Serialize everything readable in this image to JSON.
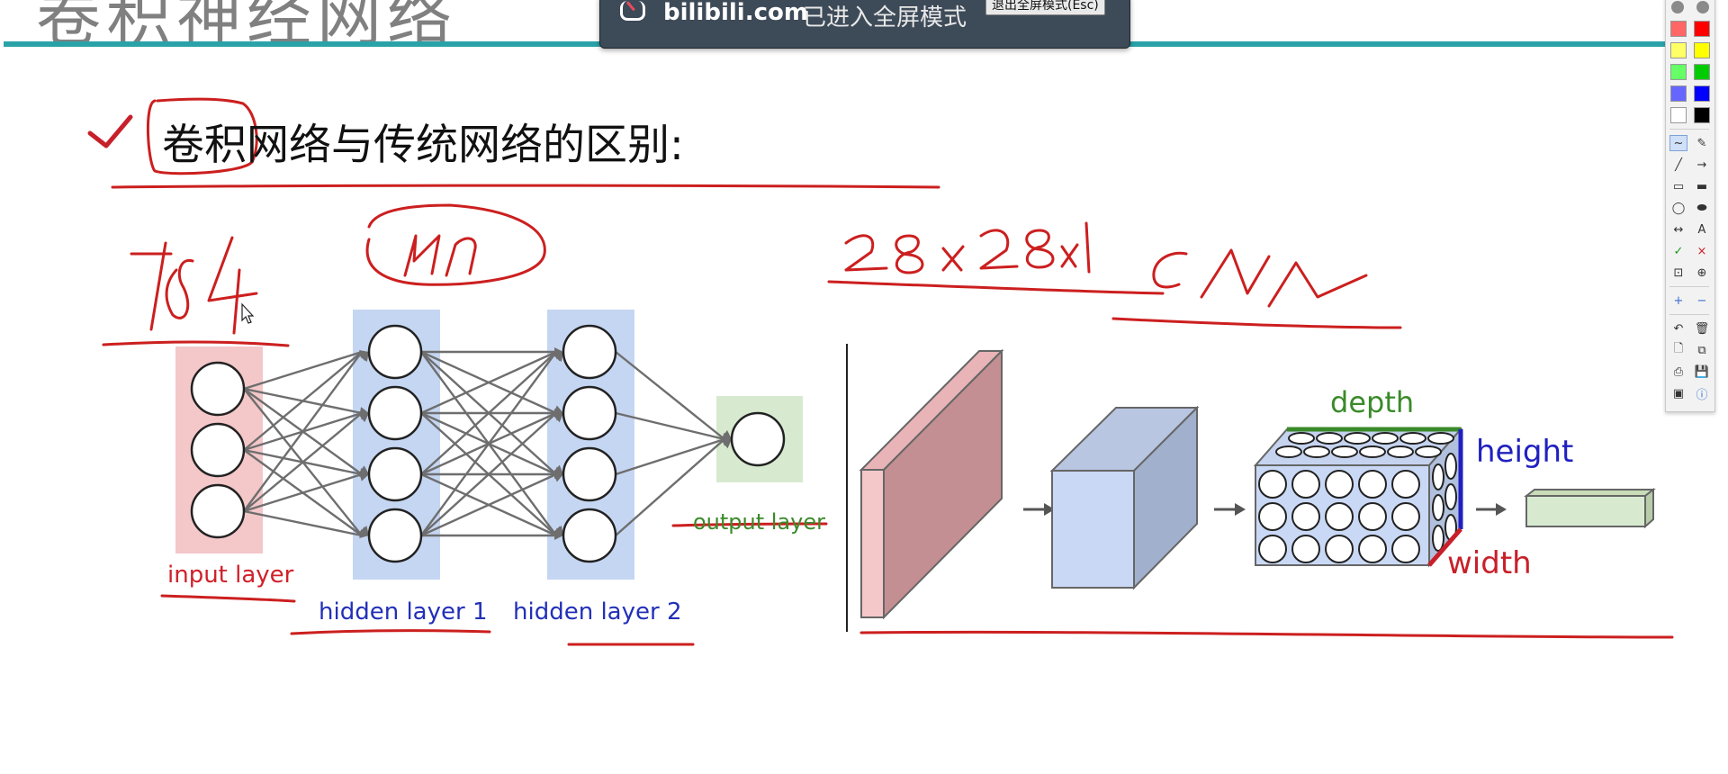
{
  "slide": {
    "title_partial": "卷积神经网络",
    "heading": "卷积网络与传统网络的区别:"
  },
  "notification": {
    "site": "bilibili.com",
    "message": "已进入全屏模式",
    "exit_button": "退出全屏模式(Esc)"
  },
  "nn_diagram": {
    "labels": {
      "input": "input layer",
      "hidden1": "hidden layer 1",
      "hidden2": "hidden layer 2",
      "output": "output layer"
    },
    "colors": {
      "input_band": "#f4c7c9",
      "hidden_band": "#c5d6f2",
      "output_band": "#d7ead0"
    }
  },
  "cnn_diagram": {
    "labels": {
      "depth": "depth",
      "height": "height",
      "width": "width"
    },
    "colors": {
      "depth": "#3a8a2a",
      "height": "#2020c0",
      "width": "#c8202a"
    }
  },
  "annotations": {
    "handwritten_784": "784",
    "handwritten_nn": "NN",
    "handwritten_28": "28×28×1",
    "handwritten_cnn": "CNN"
  },
  "toolbar": {
    "colors": [
      "#ff6666",
      "#ff0000",
      "#ffff66",
      "#ffff00",
      "#66ff66",
      "#00cc00",
      "#6666ff",
      "#0000ff",
      "#ffffff",
      "#000000"
    ],
    "tools": [
      {
        "left": "freehand-icon",
        "right": "highlighter-icon",
        "left_glyph": "~",
        "right_glyph": "✎"
      },
      {
        "left": "line-icon",
        "right": "arrow-icon",
        "left_glyph": "╱",
        "right_glyph": "→"
      },
      {
        "left": "rect-icon",
        "right": "filled-rect-icon",
        "left_glyph": "▭",
        "right_glyph": "▬"
      },
      {
        "left": "ellipse-icon",
        "right": "filled-ellipse-icon",
        "left_glyph": "◯",
        "right_glyph": "⬬"
      },
      {
        "left": "double-arrow-icon",
        "right": "text-icon",
        "left_glyph": "↔",
        "right_glyph": "A"
      },
      {
        "left": "check-icon",
        "right": "cross-icon",
        "left_glyph": "✓",
        "right_glyph": "×"
      },
      {
        "left": "crop-icon",
        "right": "zoom-icon",
        "left_glyph": "⊡",
        "right_glyph": "⊕"
      },
      {
        "left": "plus-icon",
        "right": "minus-icon",
        "left_glyph": "+",
        "right_glyph": "−"
      },
      {
        "left": "undo-icon",
        "right": "trash-icon",
        "left_glyph": "↶",
        "right_glyph": "🗑"
      },
      {
        "left": "new-page-icon",
        "right": "copy-icon",
        "left_glyph": "🗋",
        "right_glyph": "⧉"
      },
      {
        "left": "print-icon",
        "right": "save-icon",
        "left_glyph": "⎙",
        "right_glyph": "💾"
      },
      {
        "left": "screen-icon",
        "right": "info-icon",
        "left_glyph": "▣",
        "right_glyph": "ⓘ"
      }
    ]
  }
}
